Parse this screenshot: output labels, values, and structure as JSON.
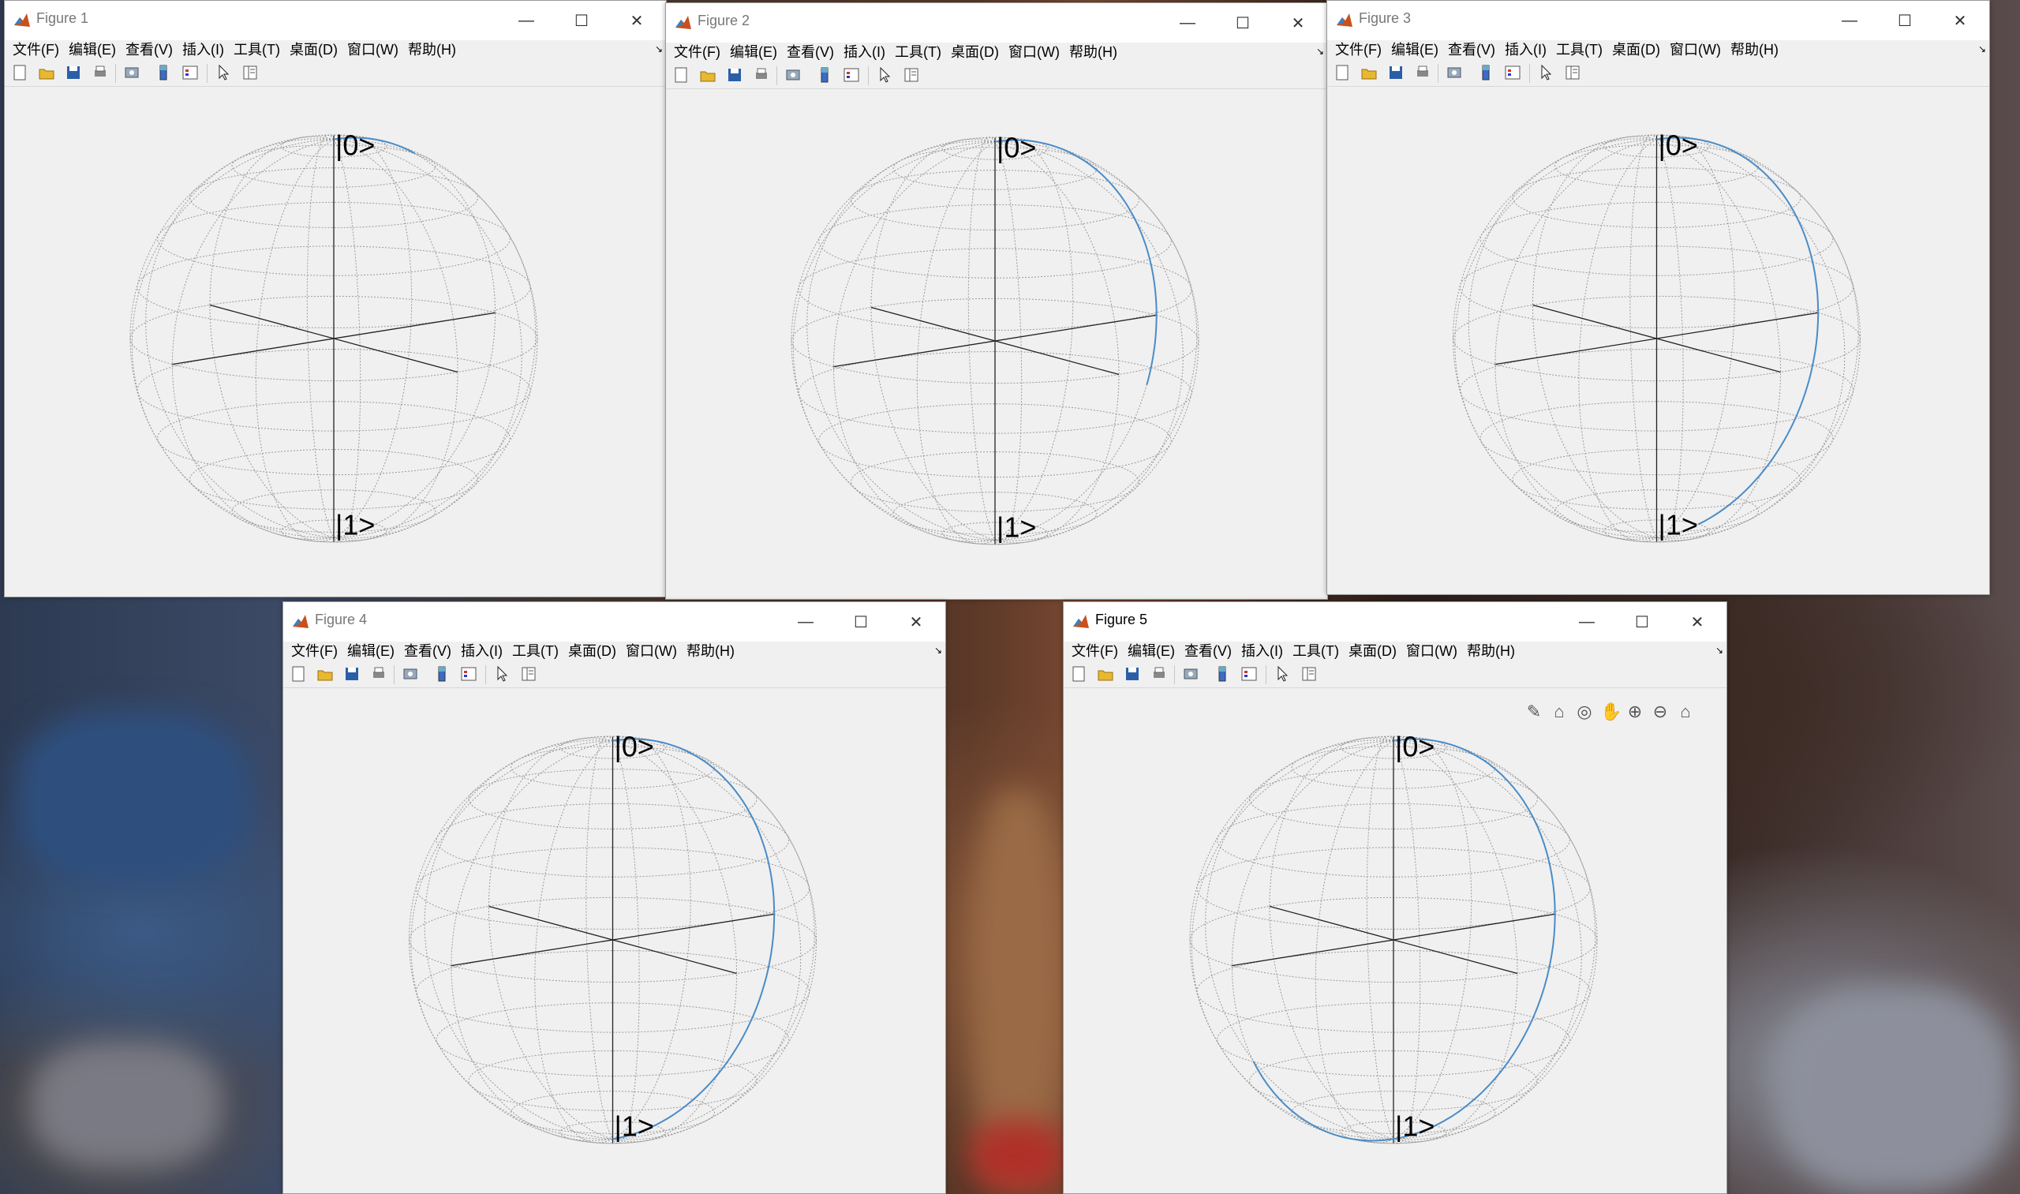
{
  "menu": [
    "文件(F)",
    "编辑(E)",
    "查看(V)",
    "插入(I)",
    "工具(T)",
    "桌面(D)",
    "窗口(W)",
    "帮助(H)"
  ],
  "window_buttons": {
    "minimize": "—",
    "maximize": "☐",
    "close": "✕"
  },
  "ket_top": "|0>",
  "ket_bottom": "|1>",
  "figures": [
    {
      "title": "Figure 1",
      "curve_theta_end_deg": 30
    },
    {
      "title": "Figure 2",
      "curve_theta_end_deg": 110
    },
    {
      "title": "Figure 3",
      "curve_theta_end_deg": 165
    },
    {
      "title": "Figure 4",
      "curve_theta_end_deg": 180
    },
    {
      "title": "Figure 5",
      "curve_theta_end_deg": 240
    }
  ],
  "toolbar_icons": [
    "new-figure-icon",
    "open-file-icon",
    "save-icon",
    "print-icon",
    "print-preview-icon",
    "colorbar-icon",
    "legend-icon",
    "pointer-icon",
    "property-inspector-icon"
  ],
  "axes_toolbar_icons": [
    "brush-icon",
    "data-tips-icon",
    "rotate-icon",
    "pan-icon",
    "zoom-in-icon",
    "zoom-out-icon",
    "home-icon"
  ],
  "colors": {
    "curve": "#4a8cc8",
    "window_bg": "#f0f0f0",
    "mesh": "#9a9a9a"
  }
}
